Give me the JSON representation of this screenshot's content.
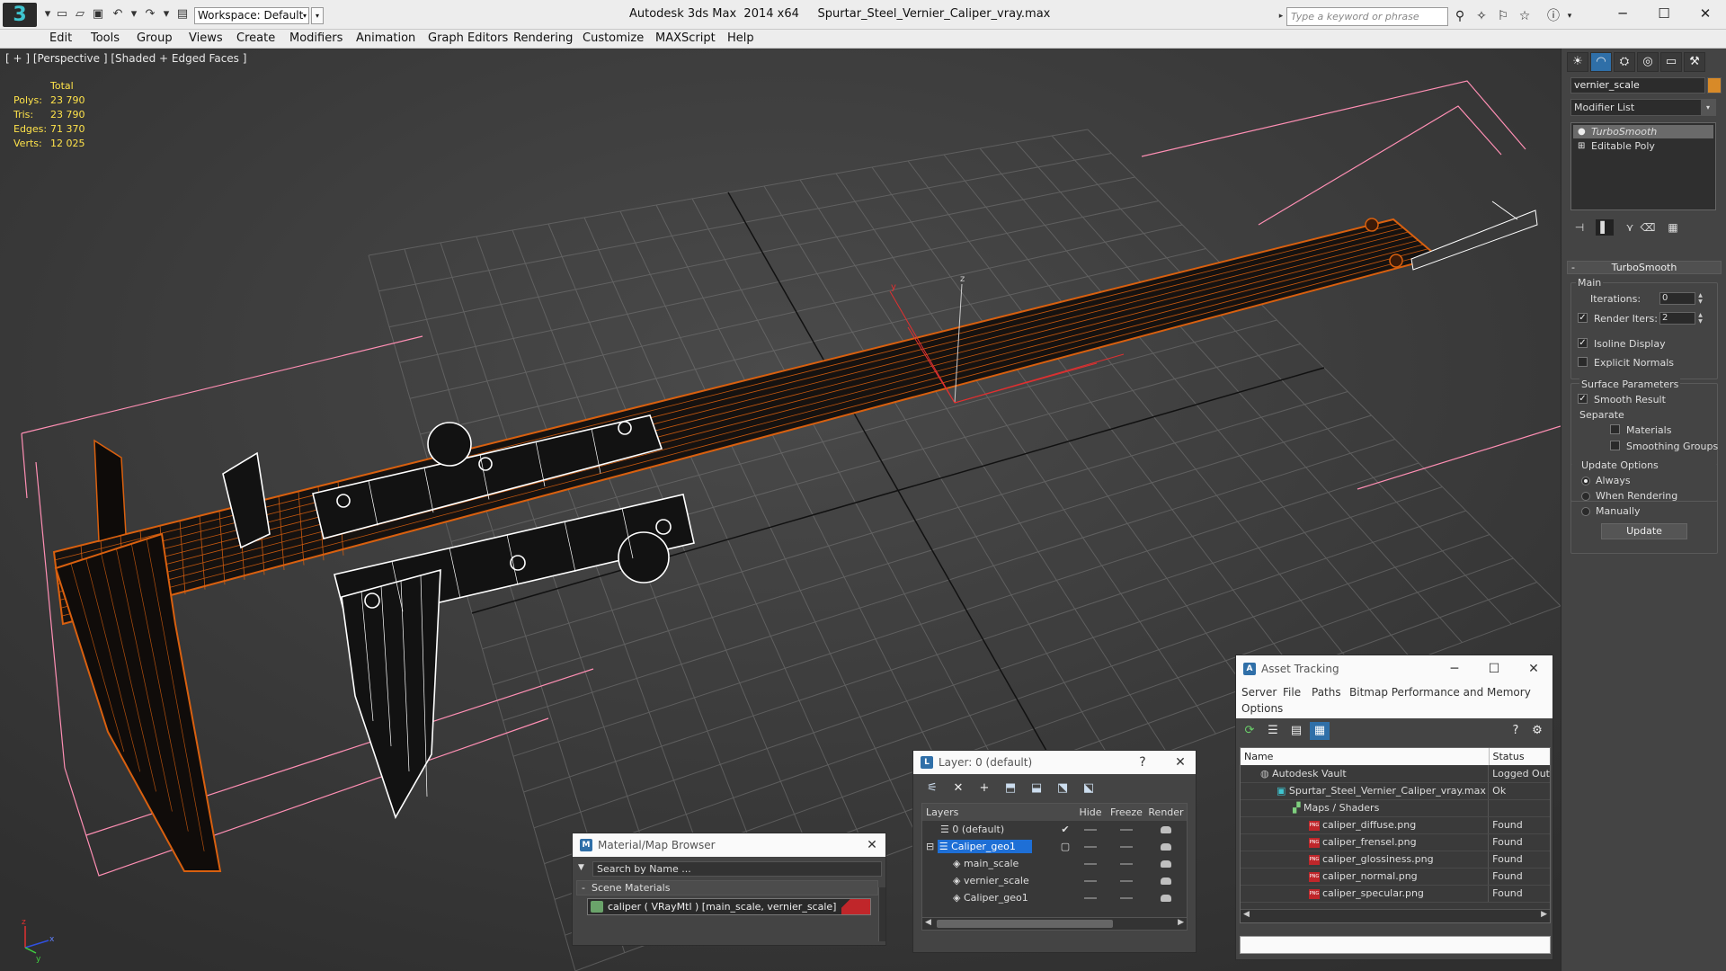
{
  "app": {
    "title": "Autodesk 3ds Max  2014 x64     Spurtar_Steel_Vernier_Caliper_vray.max",
    "workspace": "Workspace: Default",
    "search_placeholder": "Type a keyword or phrase"
  },
  "menu": [
    "Edit",
    "Tools",
    "Group",
    "Views",
    "Create",
    "Modifiers",
    "Animation",
    "Graph Editors",
    "Rendering",
    "Customize",
    "MAXScript",
    "Help"
  ],
  "viewport": {
    "label": "[ + ] [Perspective ] [Shaded + Edged Faces ]",
    "stats": {
      "header": "Total",
      "rows": [
        {
          "label": "Polys:",
          "value": "23 790"
        },
        {
          "label": "Tris:",
          "value": "23 790"
        },
        {
          "label": "Edges:",
          "value": "71 370"
        },
        {
          "label": "Verts:",
          "value": "12 025"
        }
      ]
    },
    "axis_labels": {
      "x": "x",
      "y": "y",
      "z": "z"
    }
  },
  "command_panel": {
    "tabs": [
      "☀",
      "◠",
      "⛭",
      "◎",
      "▭",
      "⚒"
    ],
    "object_name": "vernier_scale",
    "object_color": "#d88a28",
    "modifier_list": "Modifier List",
    "stack": [
      {
        "name": "TurboSmooth",
        "icon": "💡"
      },
      {
        "name": "Editable Poly",
        "icon": "+"
      }
    ],
    "turbosmooth": {
      "title": "TurboSmooth",
      "main_title": "Main",
      "iterations_label": "Iterations:",
      "iterations_value": "0",
      "render_iters_label": "Render Iters:",
      "render_iters_value": "2",
      "isoline": "Isoline Display",
      "explicit_normals": "Explicit Normals",
      "surface_title": "Surface Parameters",
      "smooth_result": "Smooth Result",
      "separate": "Separate",
      "materials": "Materials",
      "smoothing_groups": "Smoothing Groups",
      "update_title": "Update Options",
      "always": "Always",
      "when_rendering": "When Rendering",
      "manually": "Manually",
      "update_button": "Update"
    }
  },
  "material_browser": {
    "title": "Material/Map Browser",
    "search_placeholder": "Search by Name ...",
    "section": "Scene Materials",
    "item": "caliper  ( VRayMtl )  [main_scale, vernier_scale]"
  },
  "layer_dialog": {
    "title": "Layer: 0 (default)",
    "help": "?",
    "columns": [
      "Layers",
      "Hide",
      "Freeze",
      "Render"
    ],
    "rows": [
      {
        "name": "0 (default)",
        "indent": 0
      },
      {
        "name": "Caliper_geo1",
        "indent": 0
      },
      {
        "name": "main_scale",
        "indent": 1
      },
      {
        "name": "vernier_scale",
        "indent": 1
      },
      {
        "name": "Caliper_geo1",
        "indent": 1
      }
    ]
  },
  "asset_tracking": {
    "title": "Asset Tracking",
    "menu": [
      "Server",
      "File",
      "Paths",
      "Bitmap Performance and Memory",
      "Options"
    ],
    "columns": [
      "Name",
      "Status"
    ],
    "rows": [
      {
        "name": "Autodesk Vault",
        "status": "Logged Out",
        "indent": 1
      },
      {
        "name": "Spurtar_Steel_Vernier_Caliper_vray.max",
        "status": "Ok",
        "indent": 2
      },
      {
        "name": "Maps / Shaders",
        "status": "",
        "indent": 3
      },
      {
        "name": "caliper_diffuse.png",
        "status": "Found",
        "indent": 4
      },
      {
        "name": "caliper_frensel.png",
        "status": "Found",
        "indent": 4
      },
      {
        "name": "caliper_glossiness.png",
        "status": "Found",
        "indent": 4
      },
      {
        "name": "caliper_normal.png",
        "status": "Found",
        "indent": 4
      },
      {
        "name": "caliper_specular.png",
        "status": "Found",
        "indent": 4
      }
    ]
  },
  "colors": {
    "accent": "#3fc5d0",
    "wire_orange": "#d9600f",
    "selection_blue": "#1e6fd6",
    "png_red": "#c0262a"
  }
}
